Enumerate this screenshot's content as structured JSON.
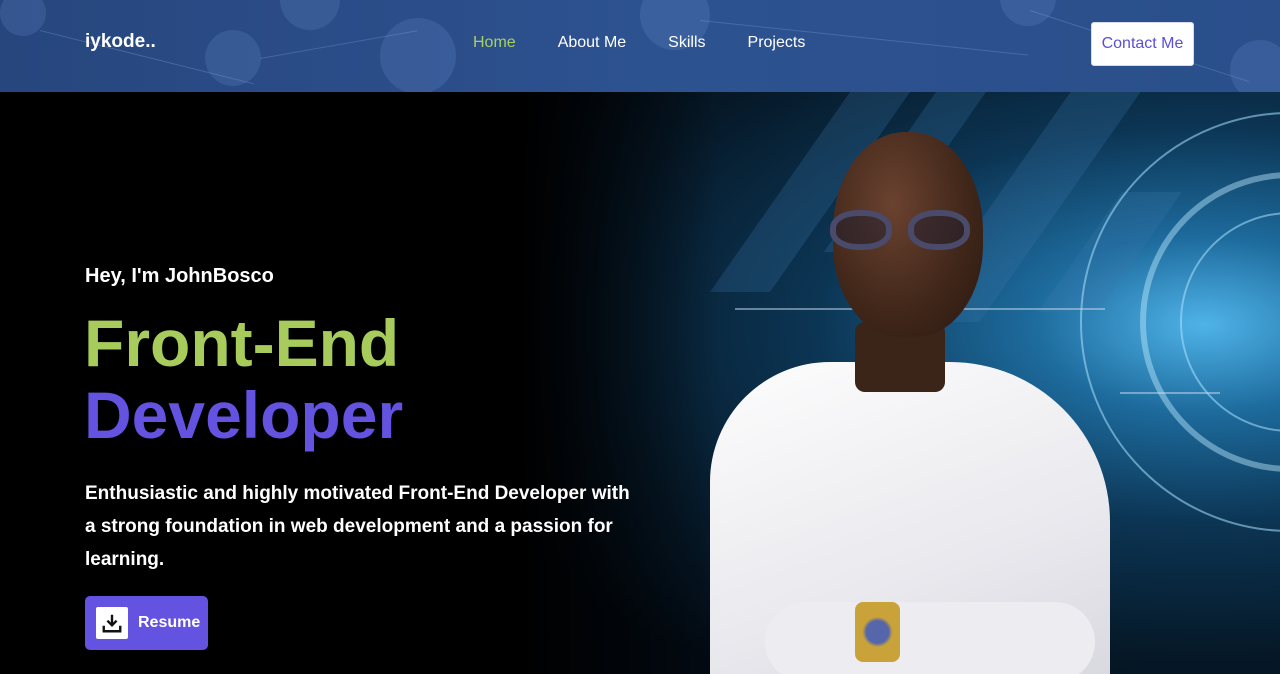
{
  "navbar": {
    "brand": "iykode..",
    "links": [
      {
        "label": "Home",
        "active": true
      },
      {
        "label": "About Me",
        "active": false
      },
      {
        "label": "Skills",
        "active": false
      },
      {
        "label": "Projects",
        "active": false
      }
    ],
    "contact_label": "Contact Me"
  },
  "hero": {
    "greeting": "Hey, I'm JohnBosco",
    "title_line1": "Front-End",
    "title_line2": "Developer",
    "description": "Enthusiastic and highly motivated Front-End Developer with a strong foundation in web development and a passion for learning.",
    "resume_label": "Resume",
    "resume_icon": "download-icon"
  },
  "colors": {
    "nav_bg": "#2d5290",
    "active_link": "#a8d063",
    "title_green": "#a8cc5c",
    "title_purple": "#6452e0",
    "button_purple": "#6452e0"
  }
}
